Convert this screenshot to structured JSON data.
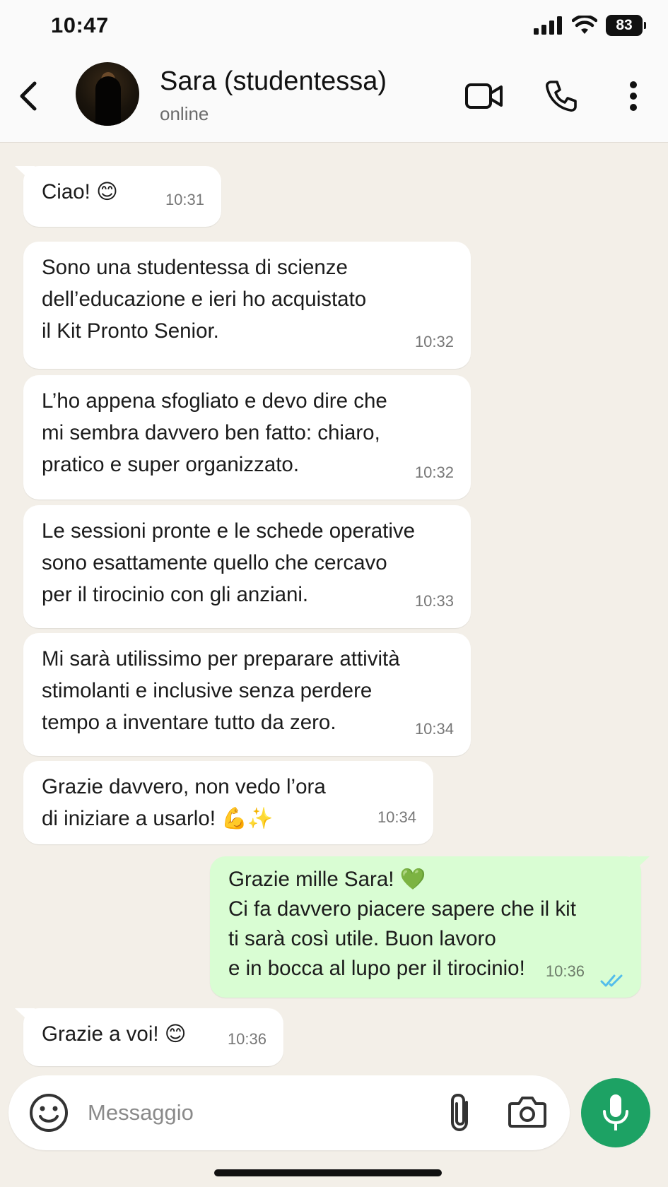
{
  "status_bar": {
    "time": "10:47",
    "battery": "83"
  },
  "header": {
    "contact_name": "Sara (studentessa)",
    "contact_status": "online"
  },
  "messages": [
    {
      "direction": "in",
      "text": "Ciao! 😊",
      "time": "10:31"
    },
    {
      "direction": "in",
      "text": "Sono una studentessa di scienze\ndell’educazione e ieri ho acquistato\nil Kit Pronto Senior.",
      "time": "10:32"
    },
    {
      "direction": "in",
      "text": "L’ho appena sfogliato e devo dire che\nmi sembra davvero ben fatto: chiaro,\npratico e super organizzato.",
      "time": "10:32"
    },
    {
      "direction": "in",
      "text": "Le sessioni pronte e le schede operative\nsono esattamente quello che cercavo\nper il tirocinio con gli anziani.",
      "time": "10:33"
    },
    {
      "direction": "in",
      "text": "Mi sarà utilissimo per preparare attività\nstimolanti e inclusive senza perdere\ntempo a inventare tutto da zero.",
      "time": "10:34"
    },
    {
      "direction": "in",
      "text": "Grazie davvero, non vedo l’ora\ndi iniziare a usarlo! 💪✨",
      "time": "10:34"
    },
    {
      "direction": "out",
      "text": "Grazie mille Sara! 💚\nCi fa davvero piacere sapere che il kit\nti sarà così utile. Buon lavoro\ne in bocca al lupo per il tirocinio!",
      "time": "10:36",
      "status": "read"
    },
    {
      "direction": "in",
      "text": "Grazie a voi! 😊",
      "time": "10:36"
    }
  ],
  "composer": {
    "placeholder": "Messaggio"
  },
  "colors": {
    "chat_background": "#f3efe8",
    "incoming_bubble": "#ffffff",
    "outgoing_bubble": "#d9fdd3",
    "mic_button": "#1da264",
    "read_ticks": "#53bdeb"
  },
  "icons": [
    "back-arrow-icon",
    "video-call-icon",
    "phone-icon",
    "more-options-icon",
    "emoji-icon",
    "paperclip-icon",
    "camera-icon",
    "microphone-icon",
    "double-check-icon",
    "signal-icon",
    "wifi-icon"
  ]
}
